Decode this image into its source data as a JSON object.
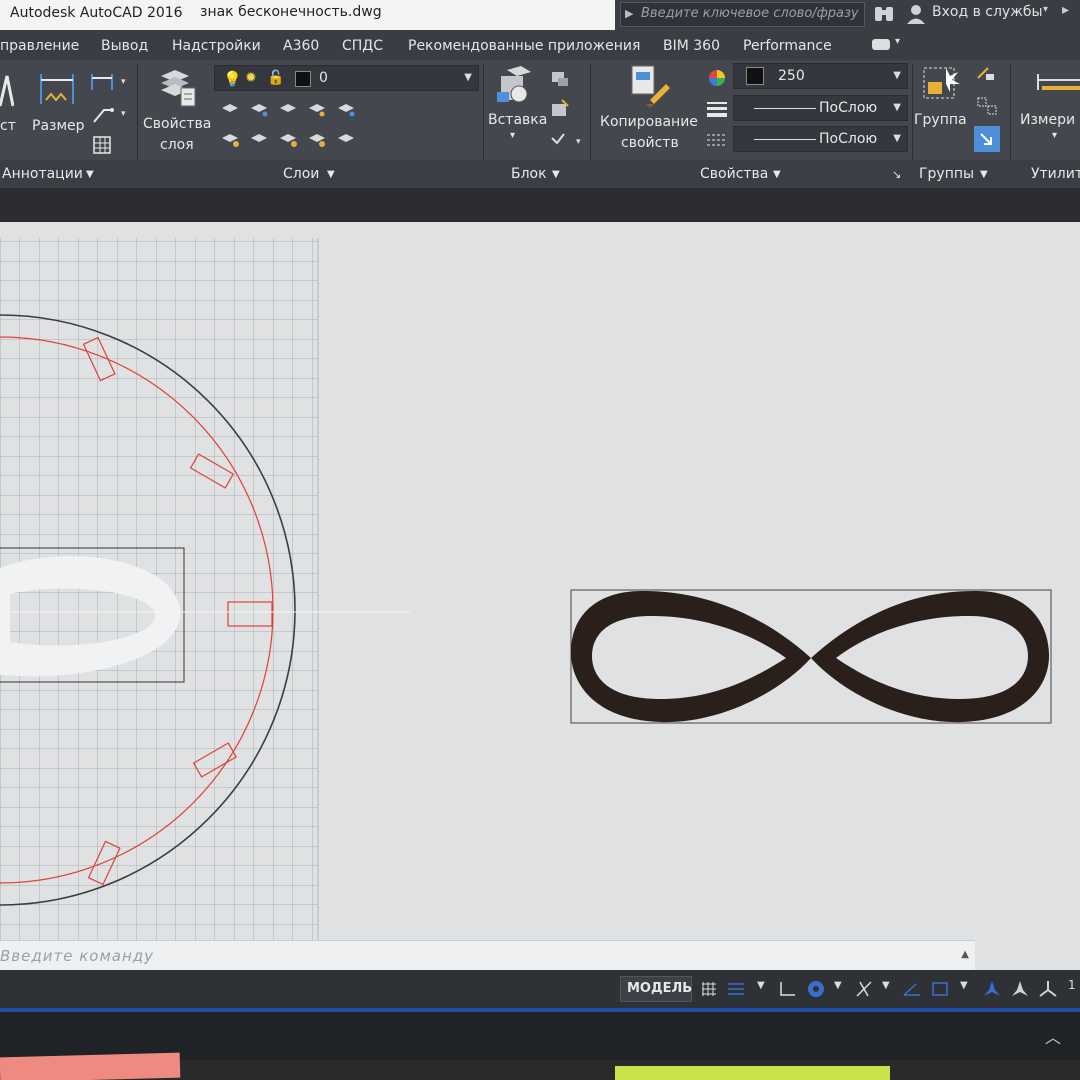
{
  "titlebar": {
    "app_title": "Autodesk AutoCAD 2016",
    "document_title": "знак бесконечность.dwg",
    "search_placeholder": "Введите ключевое слово/фразу",
    "login_label": "Вход в службы"
  },
  "menu": {
    "tabs": [
      "правление",
      "Вывод",
      "Надстройки",
      "А360",
      "СПДС",
      "Рекомендованные приложения",
      "BIM 360",
      "Performance"
    ]
  },
  "ribbon": {
    "annotation": {
      "text_label": "ст",
      "dimension_label": "Размер",
      "panel_label": "Аннотации"
    },
    "layers": {
      "layer_properties_label": [
        "Свойства",
        "слоя"
      ],
      "current_layer": "0",
      "panel_label": "Слои"
    },
    "block": {
      "insert_label": "Вставка",
      "panel_label": "Блок"
    },
    "properties": {
      "match_properties_label": [
        "Копирование",
        "свойств"
      ],
      "color_value": "250",
      "lineweight_value": "ПоСлою",
      "linetype_value": "ПоСлою",
      "panel_label": "Свойства"
    },
    "groups": {
      "group_label": "Группа",
      "panel_label": "Группы"
    },
    "utilities": {
      "measure_label": "Измери",
      "panel_label": "Утилит"
    }
  },
  "command_line": {
    "placeholder": "Введите команду"
  },
  "statusbar": {
    "model_label": "МОДЕЛЬ",
    "scale_fragment": "1"
  },
  "colors": {
    "ribbon_bg": "#44474e",
    "canvas_bg": "#dfe1e3",
    "red_circle": "#e0403a",
    "infinity_fill": "#2a1f1b",
    "accent_blue": "#1e4fa8"
  }
}
